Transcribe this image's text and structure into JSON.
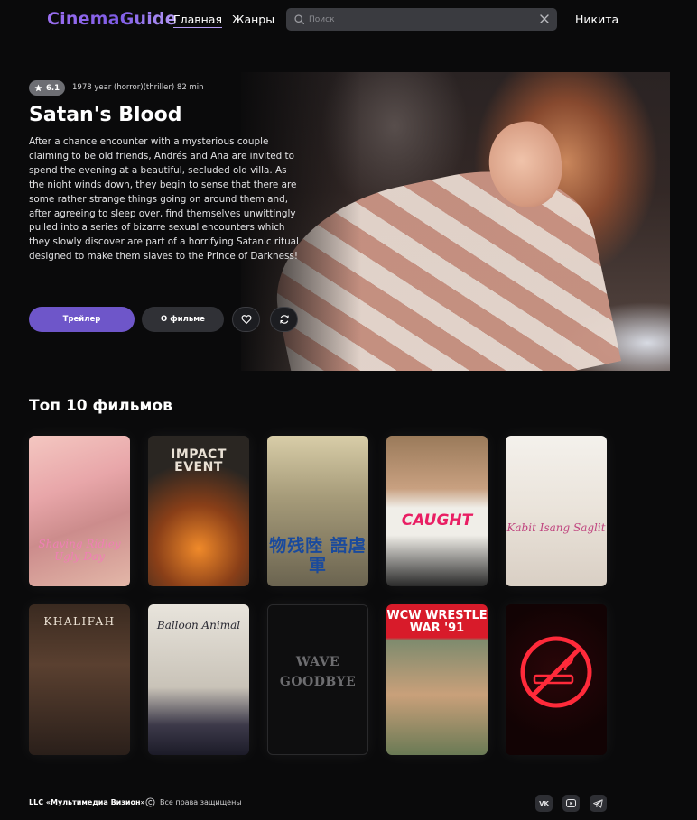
{
  "header": {
    "logo": "CinemaGuide",
    "nav": [
      {
        "label": "Главная",
        "active": true
      },
      {
        "label": "Жанры",
        "active": false
      }
    ],
    "search": {
      "placeholder": "Поиск",
      "value": ""
    },
    "user_name": "Никита"
  },
  "hero": {
    "rating": "6.1",
    "meta": "1978 year (horror)(thriller) 82 min",
    "title": "Satan's Blood",
    "description": "After a chance encounter with a mysterious couple claiming to be old friends, Andrés and Ana are invited to spend the evening at a beautiful, secluded old villa. As the night winds down, they begin to sense that there are some rather strange things going on around them and, after agreeing to sleep over, find themselves unwittingly pulled into a series of bizarre sexual encounters which they slowly discover are part of a horrifying Satanic ritual designed to make them slaves to the Prince of Darkness!",
    "trailer_label": "Трейлер",
    "about_label": "О фильме",
    "favorite_icon": "heart-icon",
    "refresh_icon": "refresh-icon"
  },
  "top_movies": {
    "title": "Топ 10 фильмов",
    "posters": [
      {
        "poster_text": "Shaving Ridley Ugly Day"
      },
      {
        "poster_text": "IMPACT EVENT"
      },
      {
        "poster_text": "物残陸 語虐軍"
      },
      {
        "poster_text": "CAUGHT"
      },
      {
        "poster_text": "Kabit Isang Saglit"
      },
      {
        "poster_text": "KHALIFAH"
      },
      {
        "poster_text": "Balloon Animal"
      },
      {
        "poster_text": "WAVE GOODBYE"
      },
      {
        "poster_text": "WCW WRESTLE WAR '91"
      },
      {
        "poster_text": ""
      }
    ]
  },
  "footer": {
    "company": "LLC «Мультимедиа Визион»",
    "rights": "Все права защищены",
    "social": [
      {
        "name": "vk-icon",
        "label": "VK"
      },
      {
        "name": "youtube-icon"
      },
      {
        "name": "telegram-icon"
      }
    ]
  },
  "colors": {
    "accent": "#6e56c9",
    "background": "#0a0a0b",
    "search_bg": "#3a3b40",
    "button_dark": "#303136"
  }
}
